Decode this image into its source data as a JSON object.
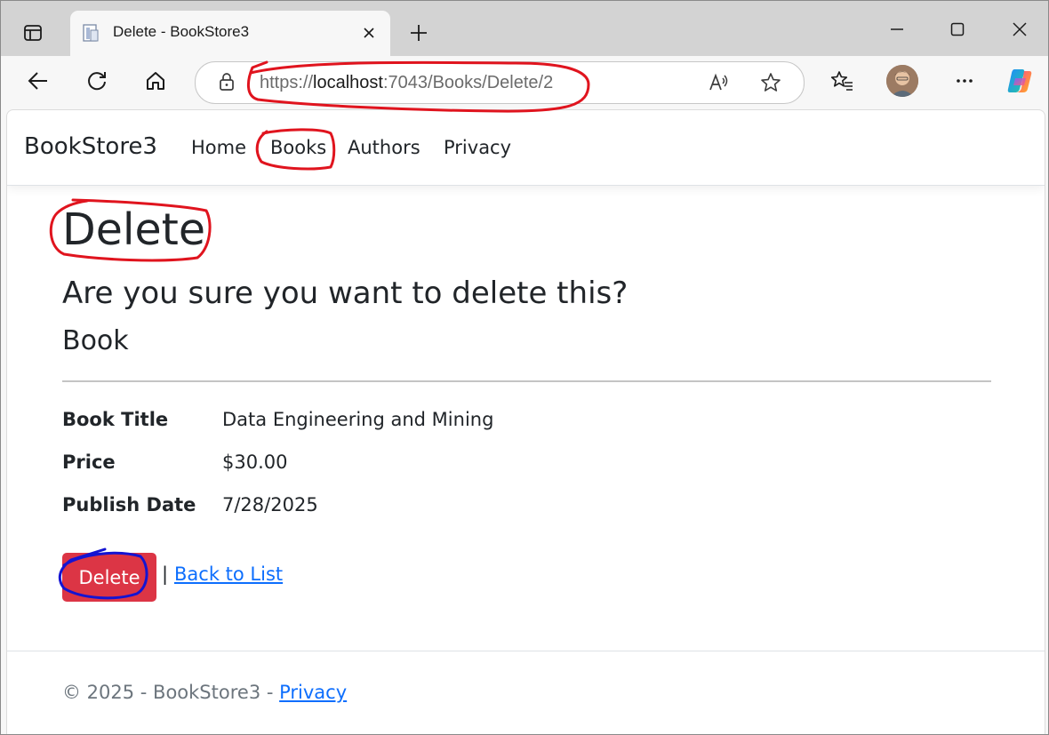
{
  "browser": {
    "tab_title": "Delete - BookStore3",
    "url_scheme": "https://",
    "url_host": "localhost",
    "url_rest": ":7043/Books/Delete/2",
    "icons": {
      "tab_actions": "tab-actions-icon",
      "favicon": "page-favicon-icon",
      "close_tab": "close-icon",
      "new_tab": "plus-icon",
      "minimize": "minimize-icon",
      "maximize": "maximize-icon",
      "close_window": "close-window-icon",
      "back": "back-arrow-icon",
      "refresh": "refresh-icon",
      "home": "home-icon",
      "lock": "lock-icon",
      "read_aloud": "read-aloud-icon",
      "favorite": "star-icon",
      "favorites_list": "favorites-icon",
      "more": "more-icon",
      "copilot": "copilot-icon"
    }
  },
  "site": {
    "brand": "BookStore3",
    "nav": [
      "Home",
      "Books",
      "Authors",
      "Privacy"
    ]
  },
  "page": {
    "heading": "Delete",
    "question": "Are you sure you want to delete this?",
    "entity": "Book",
    "fields": [
      {
        "label": "Book Title",
        "value": "Data Engineering and Mining"
      },
      {
        "label": "Price",
        "value": "$30.00"
      },
      {
        "label": "Publish Date",
        "value": "7/28/2025"
      }
    ],
    "delete_button": "Delete",
    "separator": "|",
    "back_link": "Back to List"
  },
  "footer": {
    "text": "© 2025 - BookStore3 - ",
    "link": "Privacy"
  },
  "colors": {
    "danger": "#dc3545",
    "link": "#0d6efd",
    "annotation_red": "#e0141e",
    "annotation_blue": "#1414d2"
  }
}
